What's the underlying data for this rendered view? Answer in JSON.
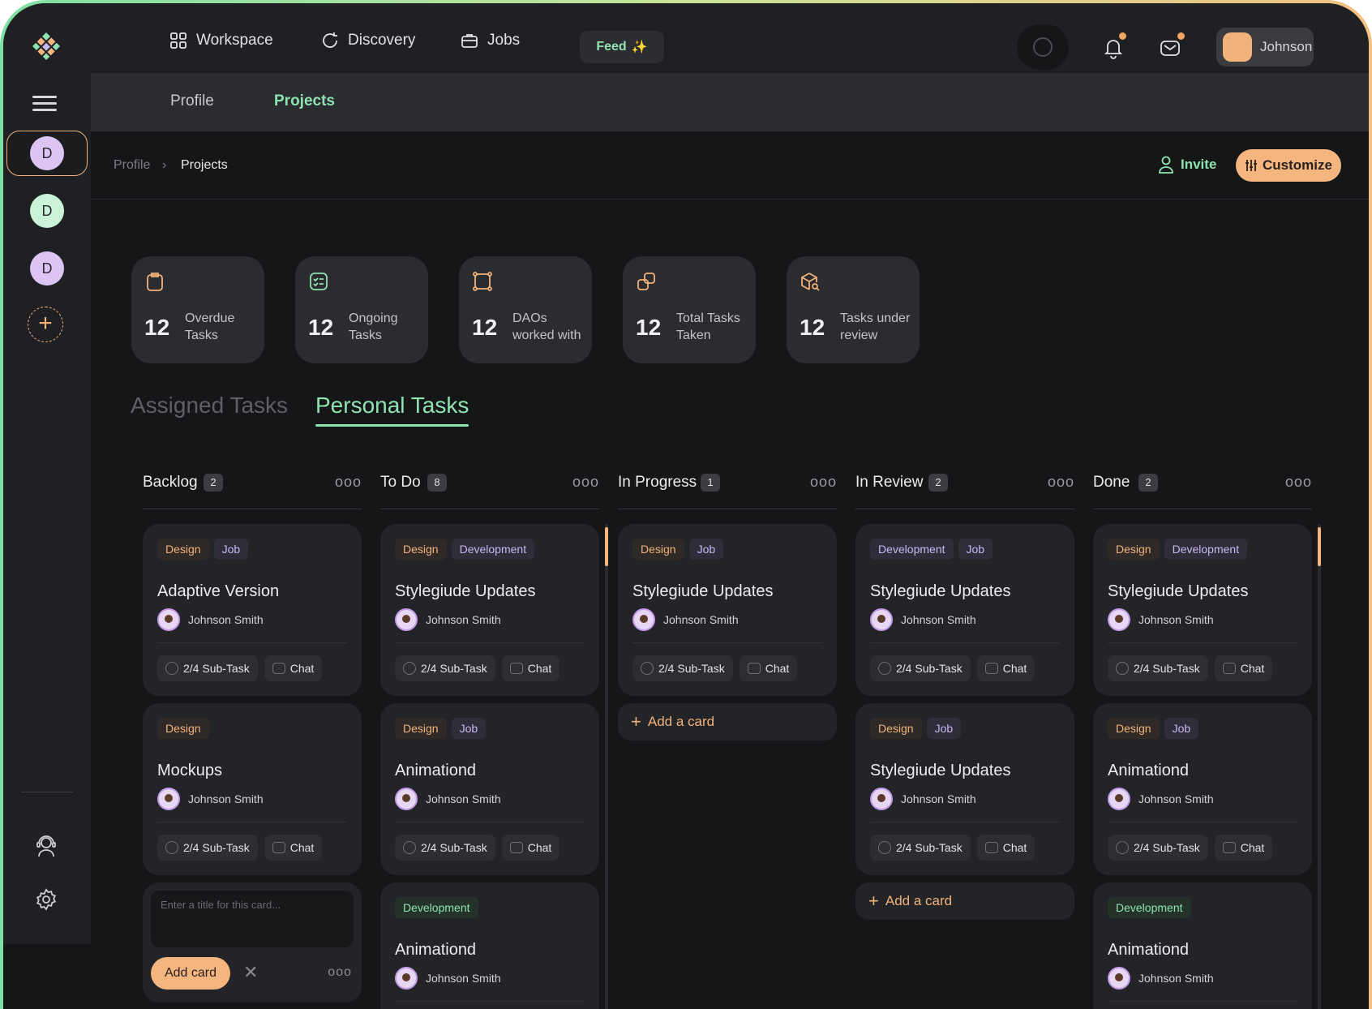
{
  "nav": {
    "workspace": "Workspace",
    "discovery": "Discovery",
    "jobs": "Jobs",
    "feed": "Feed",
    "user": "Johnson"
  },
  "rail": {
    "workspaces": [
      "D",
      "D",
      "D"
    ],
    "workspace_colors": [
      "#dcc4f4",
      "#c9f2d6",
      "#dcc4f4"
    ]
  },
  "subnav": {
    "profile": "Profile",
    "projects": "Projects"
  },
  "breadcrumb": {
    "parent": "Profile",
    "current": "Projects"
  },
  "actions": {
    "invite": "Invite",
    "customize": "Customize"
  },
  "stats": [
    {
      "value": "12",
      "label_1": "Overdue",
      "label_2": "Tasks",
      "icon": "clipboard-icon"
    },
    {
      "value": "12",
      "label_1": "Ongoing",
      "label_2": "Tasks",
      "icon": "checklist-icon"
    },
    {
      "value": "12",
      "label_1": "DAOs",
      "label_2": "worked with",
      "icon": "frame-icon"
    },
    {
      "value": "12",
      "label_1": "Total Tasks",
      "label_2": "Taken",
      "icon": "copy-icon"
    },
    {
      "value": "12",
      "label_1": "Tasks under",
      "label_2": "review",
      "icon": "box-search-icon"
    }
  ],
  "task_tabs": {
    "assigned": "Assigned Tasks",
    "personal": "Personal Tasks"
  },
  "card_common": {
    "assignee": "Johnson Smith",
    "subtask": "2/4 Sub-Task",
    "chat": "Chat",
    "add_card": "Add a card"
  },
  "new_card": {
    "placeholder": "Enter a title for this card...",
    "add_button": "Add card"
  },
  "columns": [
    {
      "title": "Backlog",
      "count": "2",
      "cards": [
        {
          "tags": [
            "Design",
            "Job"
          ],
          "title": "Adaptive Version"
        },
        {
          "tags": [
            "Design"
          ],
          "title": "Mockups"
        }
      ]
    },
    {
      "title": "To Do",
      "count": "8",
      "cards": [
        {
          "tags": [
            "Design",
            "Development"
          ],
          "title": "Stylegiude Updates"
        },
        {
          "tags": [
            "Design",
            "Job"
          ],
          "title": "Animationd"
        },
        {
          "tags": [
            "Development"
          ],
          "title": "Animationd"
        }
      ]
    },
    {
      "title": "In Progress",
      "count": "1",
      "cards": [
        {
          "tags": [
            "Design",
            "Job"
          ],
          "title": "Stylegiude Updates"
        }
      ]
    },
    {
      "title": "In Review",
      "count": "2",
      "cards": [
        {
          "tags": [
            "Development",
            "Job"
          ],
          "title": "Stylegiude Updates"
        },
        {
          "tags": [
            "Design",
            "Job"
          ],
          "title": "Stylegiude Updates"
        }
      ]
    },
    {
      "title": "Done",
      "count": "2",
      "cards": [
        {
          "tags": [
            "Design",
            "Development"
          ],
          "title": "Stylegiude Updates"
        },
        {
          "tags": [
            "Design",
            "Job"
          ],
          "title": "Animationd"
        },
        {
          "tags": [
            "Development"
          ],
          "title": "Animationd"
        }
      ]
    }
  ],
  "colors": {
    "accent_green": "#8fe3b0",
    "accent_orange": "#f4b67e",
    "background": "#151618",
    "panel": "#222427"
  }
}
